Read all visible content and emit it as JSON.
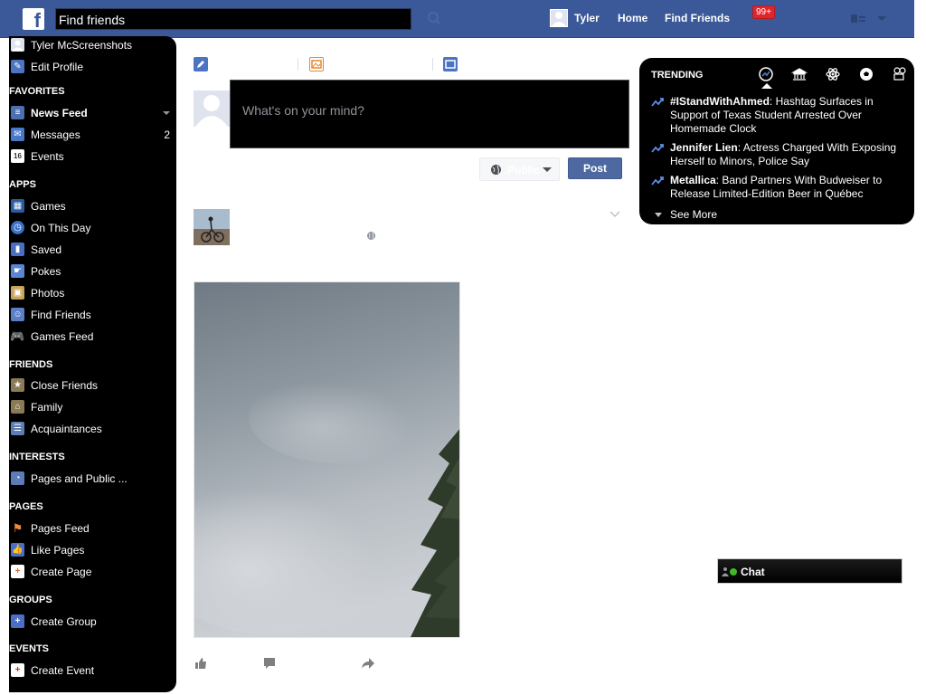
{
  "topbar": {
    "search_placeholder": "Find friends",
    "user_name": "Tyler",
    "home": "Home",
    "find_friends": "Find Friends",
    "notifications_badge": "99+"
  },
  "sidebar": {
    "profile_name": "Tyler McScreenshots",
    "edit_profile": "Edit Profile",
    "favorites_heading": "FAVORITES",
    "news_feed": "News Feed",
    "messages": "Messages",
    "messages_count": "2",
    "events": "Events",
    "events_icon_day": "16",
    "apps_heading": "APPS",
    "games": "Games",
    "on_this_day": "On This Day",
    "saved": "Saved",
    "pokes": "Pokes",
    "photos": "Photos",
    "find_friends": "Find Friends",
    "games_feed": "Games Feed",
    "friends_heading": "FRIENDS",
    "close_friends": "Close Friends",
    "family": "Family",
    "acquaintances": "Acquaintances",
    "interests_heading": "INTERESTS",
    "pages_and_public": "Pages and Public ...",
    "pages_heading": "PAGES",
    "pages_feed": "Pages Feed",
    "like_pages": "Like Pages",
    "create_page": "Create Page",
    "groups_heading": "GROUPS",
    "create_group": "Create Group",
    "events_heading": "EVENTS",
    "create_event": "Create Event"
  },
  "composer": {
    "placeholder": "What's on your mind?",
    "privacy_label": "Public",
    "post_button": "Post"
  },
  "trending": {
    "title": "TRENDING",
    "items": [
      {
        "topic": "#IStandWithAhmed",
        "headline": ": Hashtag Surfaces in Support of Texas Student Arrested Over Homemade Clock"
      },
      {
        "topic": "Jennifer Lien",
        "headline": ": Actress Charged With Exposing Herself to Minors, Police Say"
      },
      {
        "topic": "Metallica",
        "headline": ": Band Partners With Budweiser to Release Limited-Edition Beer in Québec"
      }
    ],
    "see_more": "See More",
    "peek_letters": [
      "E",
      "A",
      "F"
    ]
  },
  "chat": {
    "label": "Chat"
  },
  "colors": {
    "brand_blue": "#3b5998",
    "post_button": "#4e69a2",
    "badge_red": "#e0262c"
  }
}
